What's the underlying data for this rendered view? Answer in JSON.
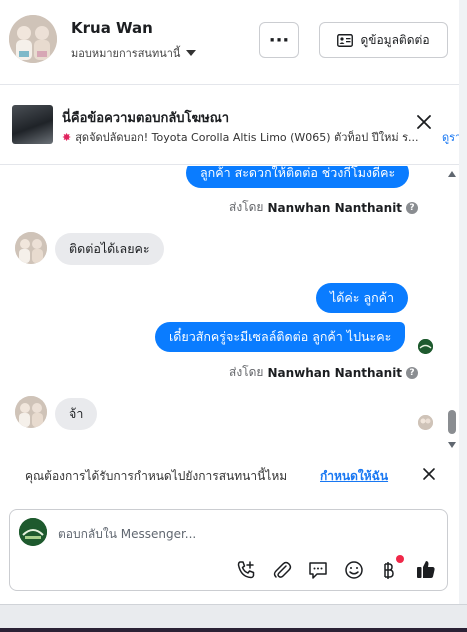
{
  "header": {
    "name": "Krua Wan",
    "assign_label": "มอบหมายการสนทนานี้",
    "more_label": "···",
    "contact_button": "ดูข้อมูลติดต่อ"
  },
  "ad_reply": {
    "title": "นี่คือข้อความตอบกลับโฆษณา",
    "subtitle": "สุดจัดปลัดบอก! Toyota Corolla Altis Limo (W065) ตัวท็อป ปีใหม่ ร...",
    "link": "ดูรา"
  },
  "messages": [
    {
      "from": "page",
      "text": "ลูกค้า สะดวกให้ติดต่อ ช่วงกี่โมงดีคะ"
    },
    {
      "sent_by_label": "ส่งโดย",
      "sent_by_name": "Nanwhan Nanthanit"
    },
    {
      "from": "customer",
      "text": "ติดต่อได้เลยคะ"
    },
    {
      "from": "page",
      "text": "ได้ค่ะ  ลูกค้า"
    },
    {
      "from": "page",
      "text": "เดี๋ยวสักครู่จะมีเซลล์ติดต่อ ลูกค้า  ไปนะคะ"
    },
    {
      "sent_by_label": "ส่งโดย",
      "sent_by_name": "Nanwhan Nanthanit"
    },
    {
      "from": "customer",
      "text": "จ้า"
    }
  ],
  "notice": {
    "text": "คุณต้องการได้รับการกำหนดไปยังการสนทนานี้ไหม",
    "link": "กำหนดให้ฉัน"
  },
  "composer": {
    "placeholder": "ตอบกลับใน Messenger..."
  },
  "icons": {
    "call": "phone-plus-icon",
    "attach": "paperclip-icon",
    "saved_reply": "chat-bubble-icon",
    "emoji": "smiley-icon",
    "payment": "baht-icon",
    "like": "thumbs-up-icon"
  },
  "colors": {
    "outgoing_bubble": "#0a7cff",
    "incoming_bubble": "#e9eaed",
    "link": "#1877f2",
    "like": "#1877f2"
  }
}
